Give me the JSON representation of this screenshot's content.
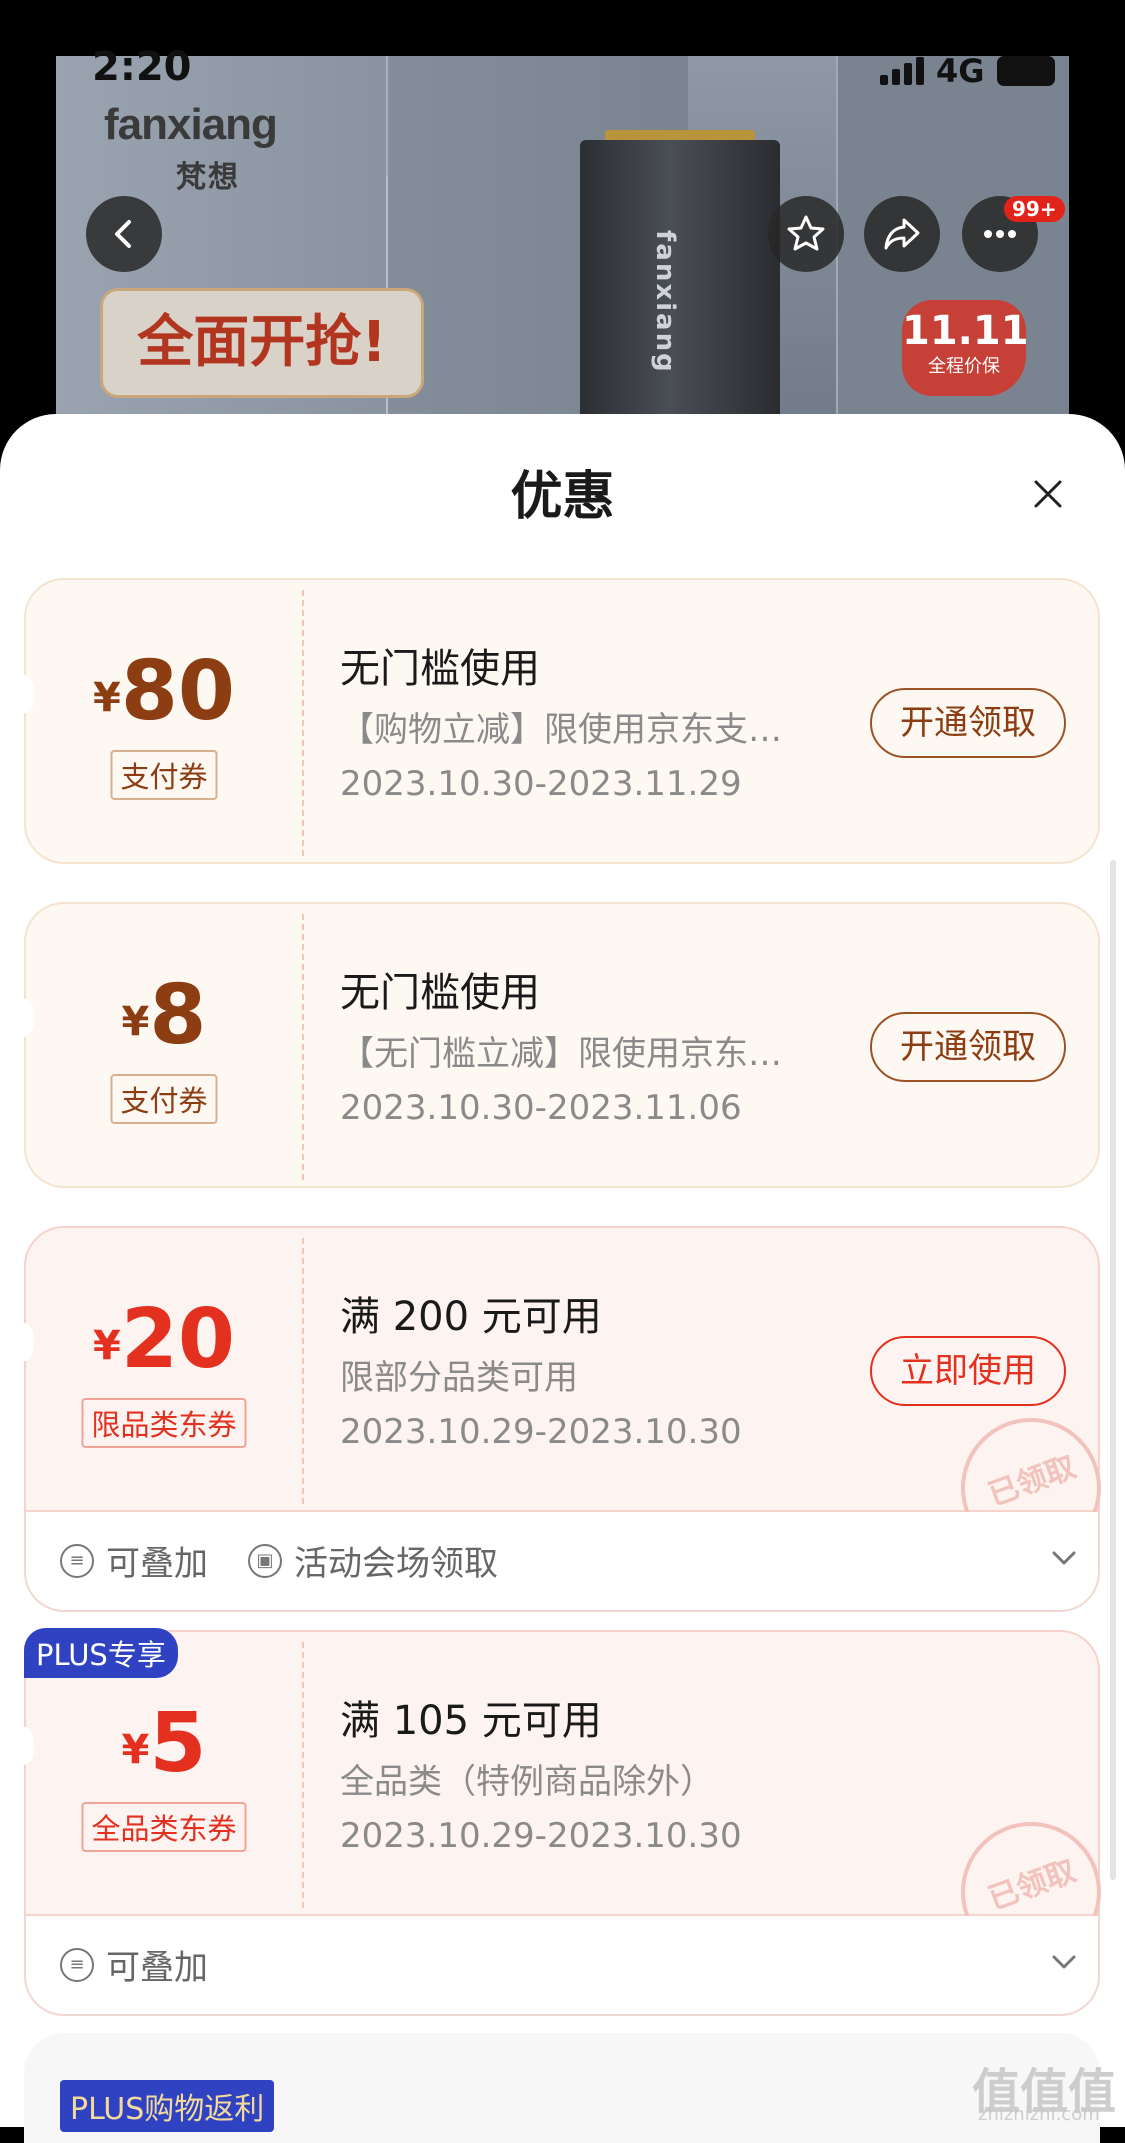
{
  "status_bar": {
    "time": "2:20",
    "network": "4G"
  },
  "hero": {
    "logo_text": "fanxiang",
    "logo_sub": "梵想",
    "promo": "全面开抢!",
    "ssd_brand": "fanxiang",
    "badge_big": "11.11",
    "badge_small": "全程价保",
    "more_badge_count": "99+"
  },
  "sheet": {
    "title": "优惠"
  },
  "coupons": [
    {
      "yen": "¥",
      "amount": "80",
      "tag": "支付券",
      "title": "无门槛使用",
      "desc": "【购物立减】限使用京东支…",
      "date": "2023.10.30-2023.11.29",
      "button": "开通领取"
    },
    {
      "yen": "¥",
      "amount": "8",
      "tag": "支付券",
      "title": "无门槛使用",
      "desc": "【无门槛立减】限使用京东…",
      "date": "2023.10.30-2023.11.06",
      "button": "开通领取"
    },
    {
      "yen": "¥",
      "amount": "20",
      "tag": "限品类东券",
      "title": "满 200 元可用",
      "desc": "限部分品类可用",
      "date": "2023.10.29-2023.10.30",
      "button": "立即使用",
      "stamp": "已领取",
      "ext_items": [
        "可叠加",
        "活动会场领取"
      ]
    },
    {
      "plus_tag": "PLUS专享",
      "yen": "¥",
      "amount": "5",
      "tag": "全品类东券",
      "title": "满 105 元可用",
      "desc": "全品类（特例商品除外）",
      "date": "2023.10.29-2023.10.30",
      "stamp": "已领取",
      "ext_items": [
        "可叠加"
      ]
    }
  ],
  "bottom": {
    "plus_rebate": "PLUS购物返利",
    "watermark": "值值值",
    "watermark_sub": "zhizhizhi.com"
  },
  "colors": {
    "accent_brown": "#8c3d12",
    "accent_red": "#e3301f",
    "plus_blue": "#2f43c2"
  }
}
